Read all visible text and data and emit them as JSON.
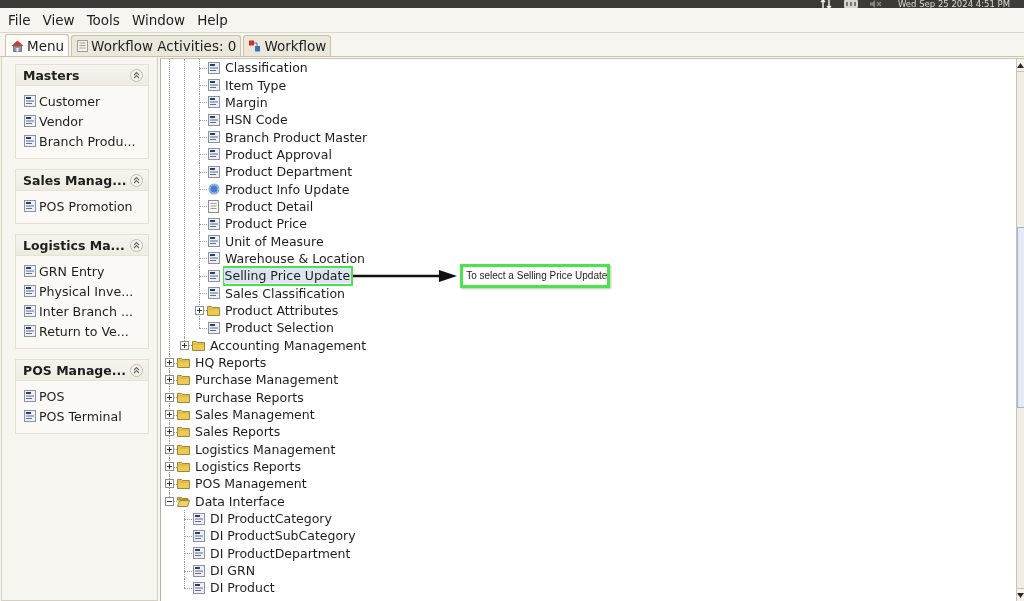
{
  "top_bar": {
    "clock": "Wed Sep 25 2024 4:51 PM"
  },
  "menu_bar": [
    {
      "label": "File"
    },
    {
      "label": "View"
    },
    {
      "label": "Tools"
    },
    {
      "label": "Window"
    },
    {
      "label": "Help"
    }
  ],
  "tabs": [
    {
      "label": "Menu",
      "kind": "home",
      "selected": true
    },
    {
      "label": "Workflow Activities: 0",
      "kind": "activities",
      "selected": false
    },
    {
      "label": "Workflow",
      "kind": "workflow",
      "selected": false
    }
  ],
  "sidebar": {
    "groups": [
      {
        "title": "Masters",
        "expanded": true,
        "items": [
          "Customer",
          "Vendor",
          "Branch Produ..."
        ]
      },
      {
        "title": "Sales Manag...",
        "expanded": true,
        "items": [
          "POS Promotion"
        ]
      },
      {
        "title": "Logistics Ma...",
        "expanded": true,
        "items": [
          "GRN Entry",
          "Physical Inve...",
          "Inter Branch ...",
          "Return to Ve..."
        ]
      },
      {
        "title": "POS Manage...",
        "expanded": true,
        "items": [
          "POS",
          "POS Terminal"
        ]
      }
    ]
  },
  "tree": {
    "items": [
      {
        "children": [
          {
            "children": [
              {
                "label": "Classification",
                "kind": "form",
                "selected": false
              },
              {
                "label": "Item Type",
                "kind": "form",
                "selected": false
              },
              {
                "label": "Margin",
                "kind": "form",
                "selected": false
              },
              {
                "label": "HSN Code",
                "kind": "form",
                "selected": false
              },
              {
                "label": "Branch Product Master",
                "kind": "form",
                "selected": false
              },
              {
                "label": "Product Approval",
                "kind": "form",
                "selected": false
              },
              {
                "label": "Product Department",
                "kind": "form",
                "selected": false
              },
              {
                "label": "Product Info Update",
                "kind": "process",
                "selected": false
              },
              {
                "label": "Product Detail",
                "kind": "report",
                "selected": false
              },
              {
                "label": "Product Price",
                "kind": "form",
                "selected": false
              },
              {
                "label": "Unit of Measure",
                "kind": "form",
                "selected": false
              },
              {
                "label": "Warehouse & Location",
                "kind": "form",
                "selected": false
              },
              {
                "label": "Selling Price Update",
                "kind": "form",
                "selected": true,
                "callout": "To select a Selling Price Update"
              },
              {
                "label": "Sales Classification",
                "kind": "form",
                "selected": false
              },
              {
                "label": "Product Attributes",
                "kind": "folder",
                "expanded": false,
                "selected": false
              },
              {
                "label": "Product Selection",
                "kind": "form",
                "selected": false
              }
            ]
          },
          {
            "label": "Accounting Management",
            "kind": "folder",
            "expanded": false,
            "selected": false
          }
        ]
      },
      {
        "label": "HQ Reports",
        "kind": "folder",
        "expanded": false,
        "selected": false
      },
      {
        "label": "Purchase Management",
        "kind": "folder",
        "expanded": false,
        "selected": false
      },
      {
        "label": "Purchase Reports",
        "kind": "folder",
        "expanded": false,
        "selected": false
      },
      {
        "label": "Sales Management",
        "kind": "folder",
        "expanded": false,
        "selected": false
      },
      {
        "label": "Sales Reports",
        "kind": "folder",
        "expanded": false,
        "selected": false
      },
      {
        "label": "Logistics Management",
        "kind": "folder",
        "expanded": false,
        "selected": false
      },
      {
        "label": "Logistics Reports",
        "kind": "folder",
        "expanded": false,
        "selected": false
      },
      {
        "label": "POS Management",
        "kind": "folder",
        "expanded": false,
        "selected": false
      },
      {
        "label": "Data Interface",
        "kind": "folder",
        "expanded": true,
        "selected": false,
        "children": [
          {
            "label": "DI ProductCategory",
            "kind": "form",
            "selected": false
          },
          {
            "label": "DI ProductSubCategory",
            "kind": "form",
            "selected": false
          },
          {
            "label": "DI ProductDepartment",
            "kind": "form",
            "selected": false
          },
          {
            "label": "DI GRN",
            "kind": "form",
            "selected": false
          },
          {
            "label": "DI Product",
            "kind": "form",
            "selected": false
          }
        ]
      }
    ]
  }
}
